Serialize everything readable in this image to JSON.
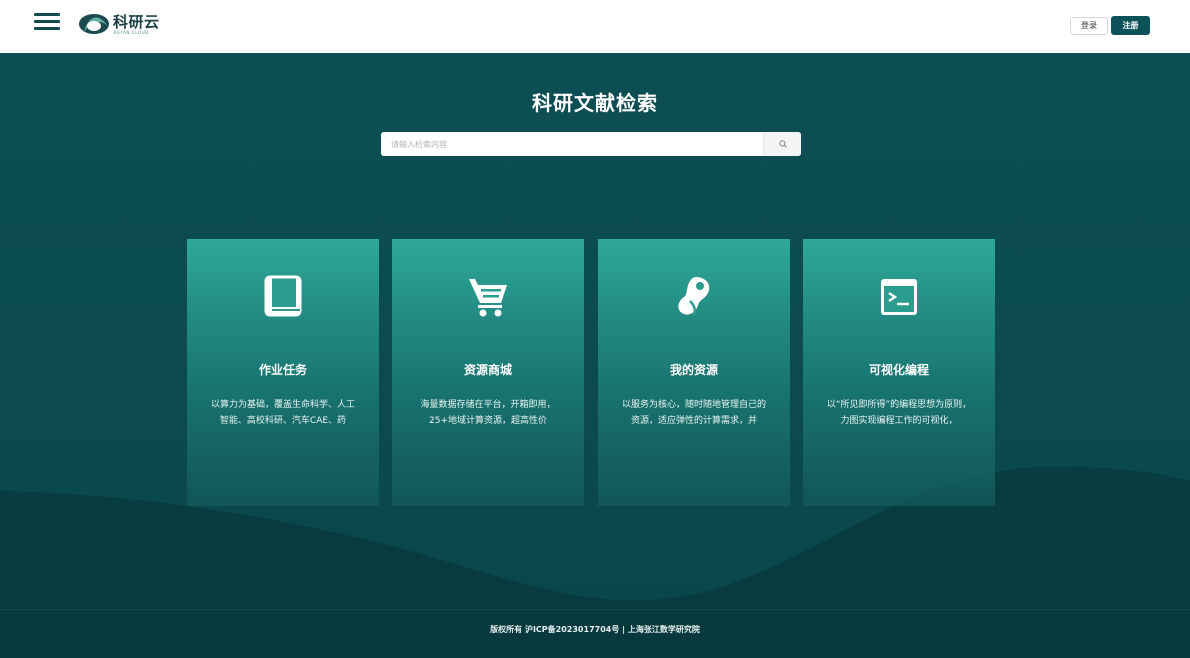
{
  "header": {
    "logo_text": "科研云",
    "logo_sub": "KEYAN CLOUD",
    "login_label": "登录",
    "register_label": "注册"
  },
  "hero": {
    "title": "科研文献检索",
    "search": {
      "placeholder": "请输入检索内容",
      "value": ""
    }
  },
  "cards": [
    {
      "icon": "book-icon",
      "title": "作业任务",
      "desc": "以算力为基础，覆盖生命科学、人工智能、高校科研、汽车CAE、药"
    },
    {
      "icon": "cart-icon",
      "title": "资源商城",
      "desc": "海量数据存储在平台，开箱即用，25+地域计算资源，超高性价"
    },
    {
      "icon": "resource-icon",
      "title": "我的资源",
      "desc": "以服务为核心，随时随地管理自己的资源，适应弹性的计算需求，并"
    },
    {
      "icon": "terminal-icon",
      "title": "可视化编程",
      "desc": "以“所见即所得”的编程思想为原则，力图实现编程工作的可视化，"
    }
  ],
  "footer": {
    "text": "版权所有 沪ICP备2023017704号 | 上海张江数学研究院"
  },
  "colors": {
    "primary": "#0d5258",
    "hero_bg": "#0b4a4f",
    "card_top": "#2fa998",
    "footer_bg": "#08393d"
  }
}
